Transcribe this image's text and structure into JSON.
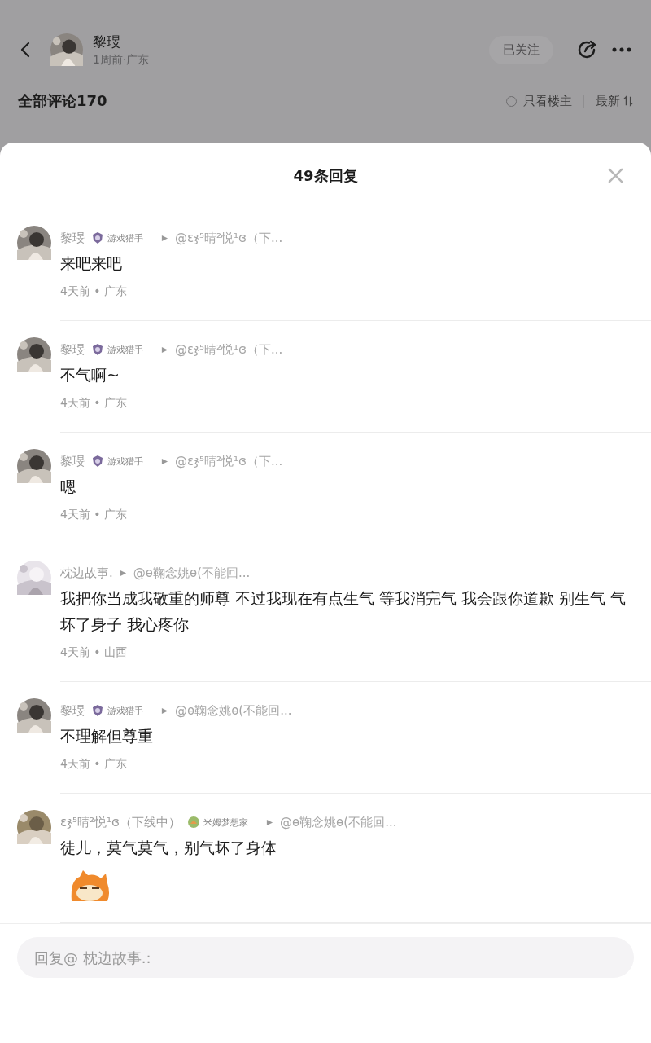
{
  "post_header": {
    "user_name": "黎琝",
    "user_meta": "1周前·广东",
    "follow_button": {
      "label": "已关注",
      "disabled": true
    }
  },
  "comments_bar": {
    "title": "全部评论170",
    "filter": {
      "label": "只看楼主",
      "checked": false
    },
    "sort": "最新"
  },
  "sheet": {
    "title": "49条回复",
    "replies": [
      {
        "name": "黎琝",
        "badge": {
          "label": "游戏猎手",
          "kind": "shield"
        },
        "reply_to": "@ɛჯ⁵晴²悦¹ɞ（下...",
        "text": "来吧来吧",
        "meta": "4天前 • 广东"
      },
      {
        "name": "黎琝",
        "badge": {
          "label": "游戏猎手",
          "kind": "shield"
        },
        "reply_to": "@ɛჯ⁵晴²悦¹ɞ（下...",
        "text": "不气啊~",
        "meta": "4天前 • 广东"
      },
      {
        "name": "黎琝",
        "badge": {
          "label": "游戏猎手",
          "kind": "shield"
        },
        "reply_to": "@ɛჯ⁵晴²悦¹ɞ（下...",
        "text": "嗯",
        "meta": "4天前 • 广东"
      },
      {
        "name": "枕边故事.",
        "reply_to": "@ɵ鞠念姚ɵ(不能回...",
        "text": "我把你当成我敬重的师尊 不过我现在有点生气 等我消完气 我会跟你道歉 别生气 气坏了身子 我心疼你",
        "meta": "4天前 • 山西"
      },
      {
        "name": "黎琝",
        "badge": {
          "label": "游戏猎手",
          "kind": "shield"
        },
        "reply_to": "@ɵ鞠念姚ɵ(不能回...",
        "text": "不理解但尊重",
        "meta": "4天前 • 广东"
      },
      {
        "name": "ɛჯ⁵晴²悦¹ɞ（下线中）",
        "badge": {
          "label": "米姆梦想家",
          "kind": "leaf"
        },
        "reply_to": "@ɵ鞠念姚ɵ(不能回...",
        "text": "徒儿，莫气莫气，别气坏了身体",
        "sticker": true
      }
    ],
    "reply_box": {
      "placeholder": "回复@ 枕边故事.:"
    }
  }
}
